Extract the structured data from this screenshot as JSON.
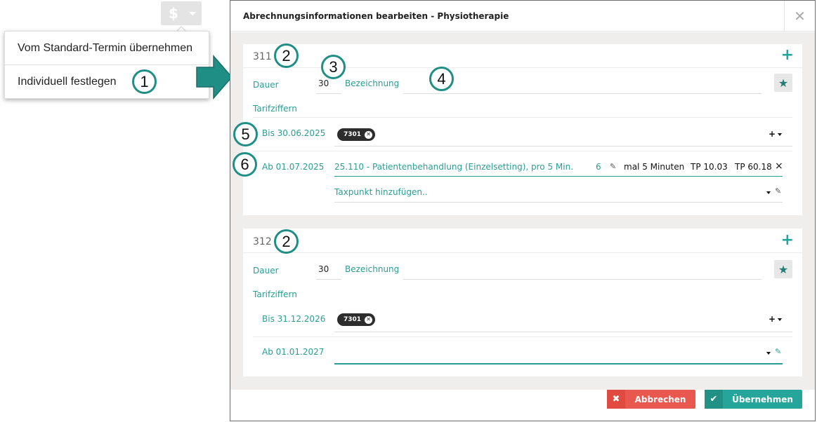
{
  "toolbar": {
    "currency_symbol": "$"
  },
  "dropdown_menu": {
    "items": [
      {
        "label": "Vom Standard-Termin übernehmen"
      },
      {
        "label": "Individuell festlegen"
      }
    ]
  },
  "callouts": [
    "1",
    "2",
    "3",
    "4",
    "5",
    "6"
  ],
  "modal": {
    "title": "Abrechnungsinformationen bearbeiten - Physiotherapie",
    "close_symbol": "✕",
    "panels": [
      {
        "code": "311",
        "duration_label": "Dauer",
        "duration_value": "30",
        "name_label": "Bezeichnung",
        "tariff_label": "Tarifziffern",
        "periods": [
          {
            "label": "Bis 30.06.2025",
            "chip": "7301"
          },
          {
            "label": "Ab 01.07.2025",
            "entry_text": "25.110 - Patientenbehandlung (Einzelsetting), pro 5 Min.",
            "entry_qty": "6",
            "entry_unit": "mal 5 Minuten",
            "entry_tp1": "TP 10.03",
            "entry_tp2": "TP 60.18",
            "remove_symbol": "×",
            "add_placeholder": "Taxpunkt hinzufügen.."
          }
        ]
      },
      {
        "code": "312",
        "duration_label": "Dauer",
        "duration_value": "30",
        "name_label": "Bezeichnung",
        "tariff_label": "Tarifziffern",
        "periods": [
          {
            "label": "Bis 31.12.2026",
            "chip": "7301"
          },
          {
            "label": "Ab 01.01.2027"
          }
        ]
      }
    ],
    "buttons": {
      "cancel": "Abbrechen",
      "apply": "Übernehmen"
    }
  },
  "colors": {
    "accent": "#26a69a",
    "danger": "#e9584e",
    "callout_ring": "#1f8f86"
  }
}
